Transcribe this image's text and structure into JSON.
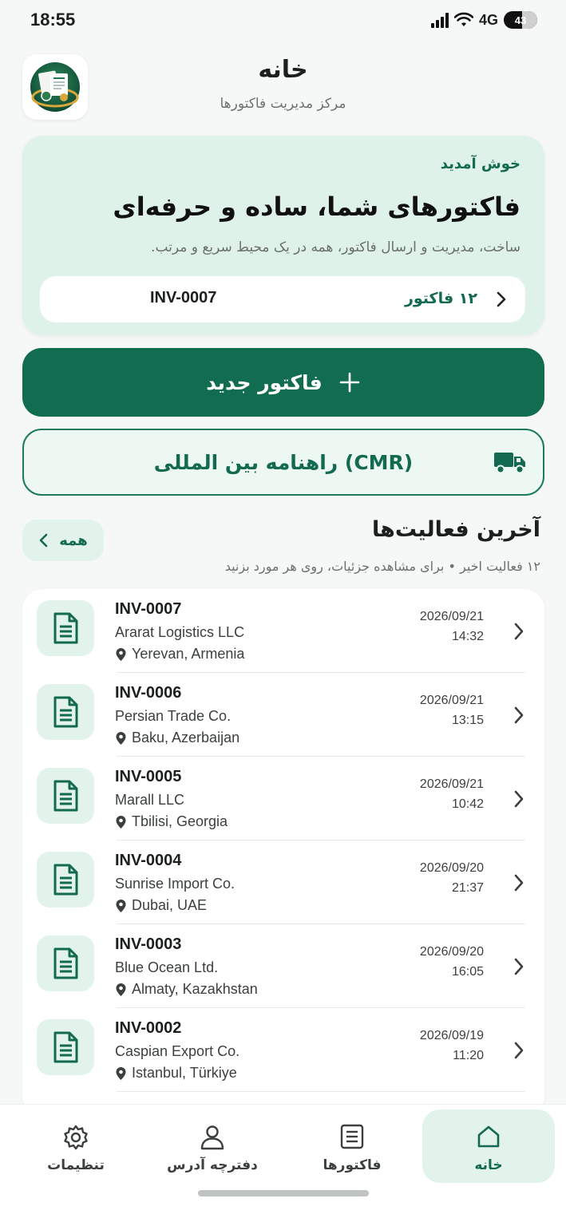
{
  "status_bar": {
    "time": "18:55",
    "network": "4G",
    "battery": "43"
  },
  "header": {
    "title": "خانه",
    "subtitle": "مرکز مدیریت فاکتورها"
  },
  "hero": {
    "welcome": "خوش آمدید",
    "title": "فاکتورهای شما، ساده و حرفه‌ای",
    "description": "ساخت، مدیریت و ارسال فاکتور، همه در یک محیط سریع و مرتب.",
    "invoice_count": "۱۲ فاکتور",
    "latest_invoice": "INV-0007"
  },
  "actions": {
    "new_invoice": "فاکتور جدید",
    "cmr_guide": "راهنامه بین المللی (CMR)"
  },
  "recent": {
    "title": "آخرین فعالیت‌ها",
    "subtitle": "۱۲ فعالیت اخیر • برای مشاهده جزئیات، روی هر مورد بزنید",
    "all_label": "همه",
    "items": [
      {
        "invoice": "INV-0007",
        "company": "Ararat Logistics LLC",
        "location": "Yerevan, Armenia",
        "date": "2026/09/21",
        "time": "14:32"
      },
      {
        "invoice": "INV-0006",
        "company": "Persian Trade Co.",
        "location": "Baku, Azerbaijan",
        "date": "2026/09/21",
        "time": "13:15"
      },
      {
        "invoice": "INV-0005",
        "company": "Marall LLC",
        "location": "Tbilisi, Georgia",
        "date": "2026/09/21",
        "time": "10:42"
      },
      {
        "invoice": "INV-0004",
        "company": "Sunrise Import Co.",
        "location": "Dubai, UAE",
        "date": "2026/09/20",
        "time": "21:37"
      },
      {
        "invoice": "INV-0003",
        "company": "Blue Ocean Ltd.",
        "location": "Almaty, Kazakhstan",
        "date": "2026/09/20",
        "time": "16:05"
      },
      {
        "invoice": "INV-0002",
        "company": "Caspian Export Co.",
        "location": "Istanbul, Türkiye",
        "date": "2026/09/19",
        "time": "11:20"
      }
    ]
  },
  "nav": {
    "home": "خانه",
    "invoices": "فاکتورها",
    "address_book": "دفترچه آدرس",
    "settings": "تنظیمات"
  },
  "colors": {
    "primary": "#126c50",
    "accent_bg": "#e2f3ec",
    "hero_bg": "#dff2ea"
  }
}
